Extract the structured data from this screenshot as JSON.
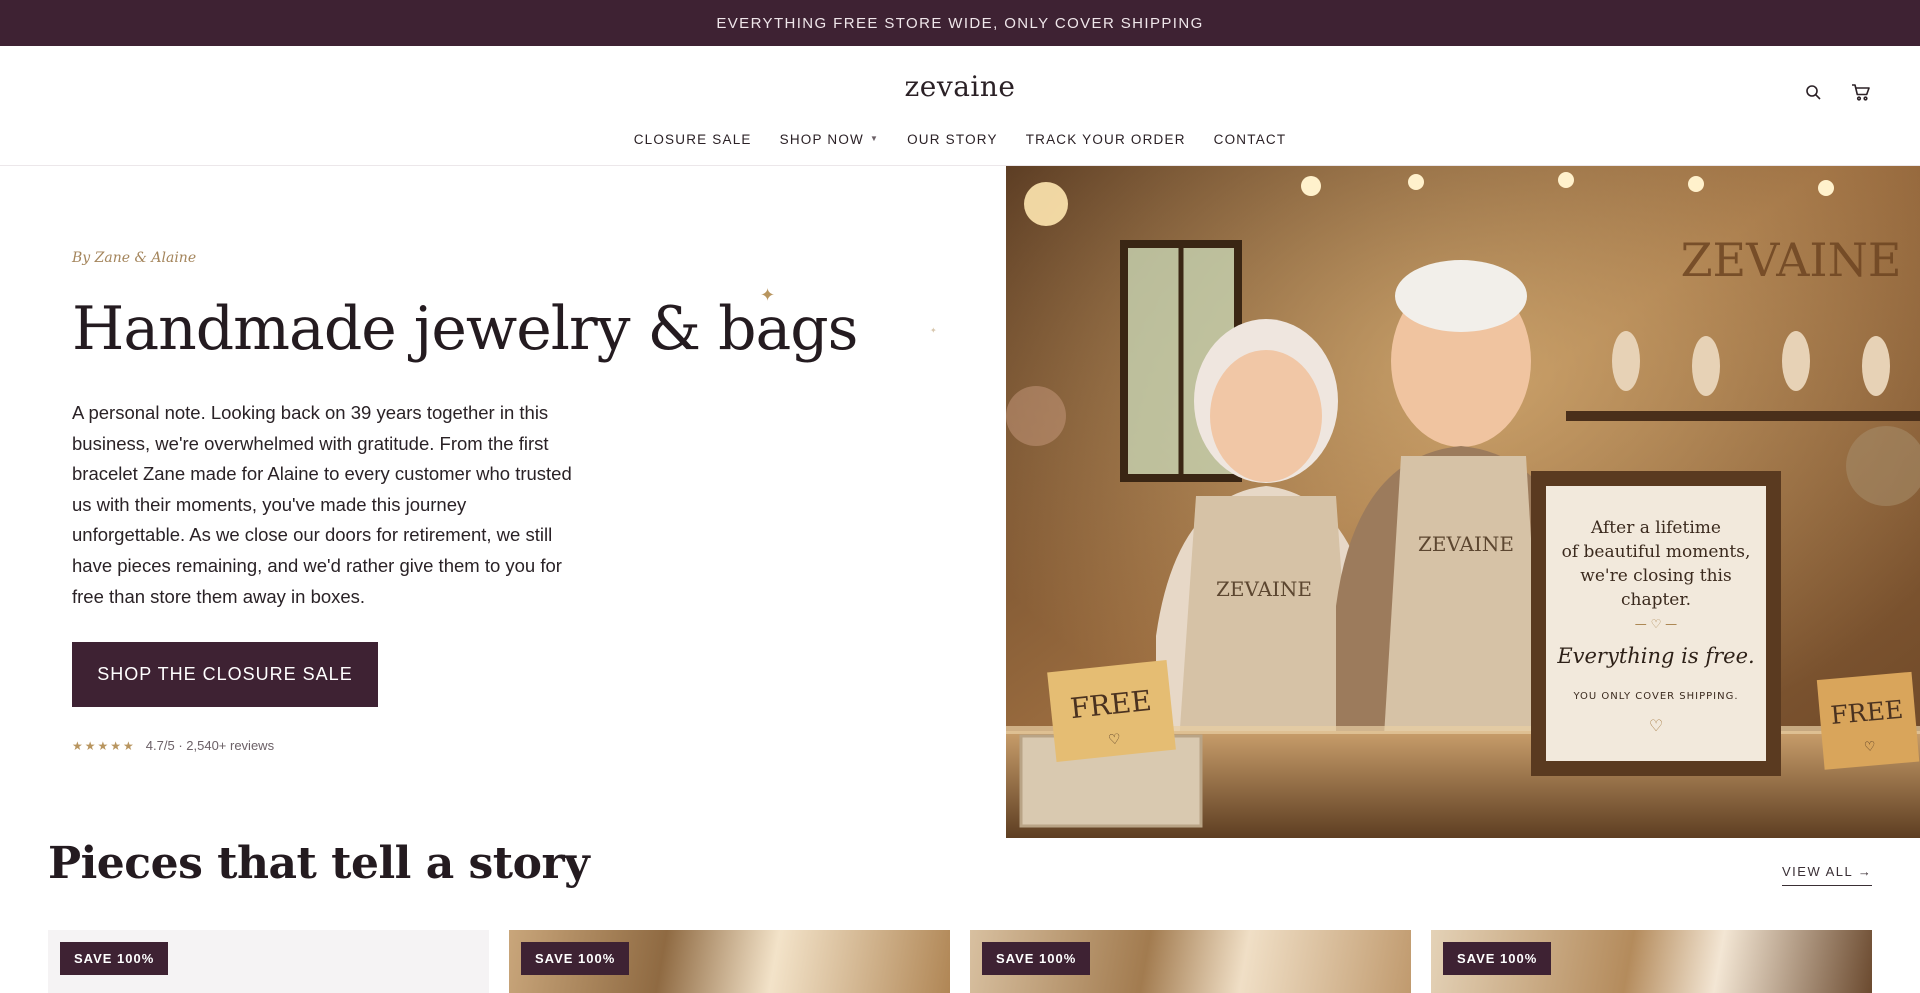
{
  "announcement": "EVERYTHING FREE STORE WIDE, ONLY COVER SHIPPING",
  "brand": {
    "logo": "zevaine"
  },
  "nav": {
    "items": [
      {
        "label": "CLOSURE SALE",
        "has_dropdown": false
      },
      {
        "label": "SHOP NOW",
        "has_dropdown": true
      },
      {
        "label": "OUR STORY",
        "has_dropdown": false
      },
      {
        "label": "TRACK YOUR ORDER",
        "has_dropdown": false
      },
      {
        "label": "CONTACT",
        "has_dropdown": false
      }
    ],
    "icons": [
      "search-icon",
      "cart-icon"
    ]
  },
  "hero": {
    "byline": "By Zane & Alaine",
    "title": "Handmade jewelry & bags",
    "intro": "A personal note. Looking back on 39 years together in this business, we're overwhelmed with gratitude. From the first bracelet Zane made for Alaine to every customer who trusted us with their moments, you've made this journey unforgettable. As we close our doors for retirement, we still have pieces remaining, and we'd rather give them to you for free than store them away in boxes.",
    "cta_label": "SHOP THE CLOSURE SALE",
    "rating": {
      "stars": "★★★★★",
      "text": "4.7/5 · 2,540+ reviews"
    },
    "image": {
      "wall_sign": "ZEVAINE",
      "apron_text": "ZEVAINE",
      "left_tag": "FREE",
      "right_tag": "FREE",
      "frame_line1": "After a lifetime",
      "frame_line2": "of beautiful moments,",
      "frame_line3": "we're closing this",
      "frame_line4": "chapter.",
      "frame_script": "Everything is free.",
      "frame_small": "YOU ONLY COVER SHIPPING."
    }
  },
  "collection": {
    "title": "Pieces that tell a story",
    "view_all": "VIEW ALL →",
    "badges": [
      "SAVE 100%",
      "SAVE 100%",
      "SAVE 100%",
      "SAVE 100%"
    ]
  },
  "colors": {
    "accent": "#3e2233",
    "gold": "#b8955f",
    "text": "#241b20"
  }
}
